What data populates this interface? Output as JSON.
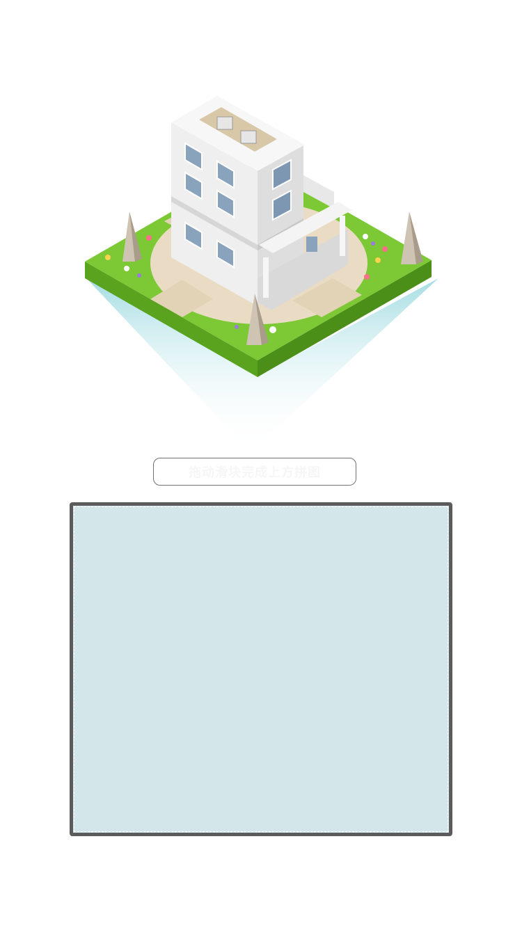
{
  "info_pill": {
    "text": "拖动滑块完成上方拼图"
  },
  "colors": {
    "grass_top": "#7cc935",
    "grass_side": "#5aa31e",
    "path": "#eadcc4",
    "water": "#a9dfe4",
    "building": "#efefef",
    "board": "#d3e6e9",
    "board_border": "#5b5b5b"
  },
  "icons": [
    "isometric-building-island-icon",
    "obelisk-icon",
    "flower-icon",
    "air-conditioner-icon"
  ]
}
